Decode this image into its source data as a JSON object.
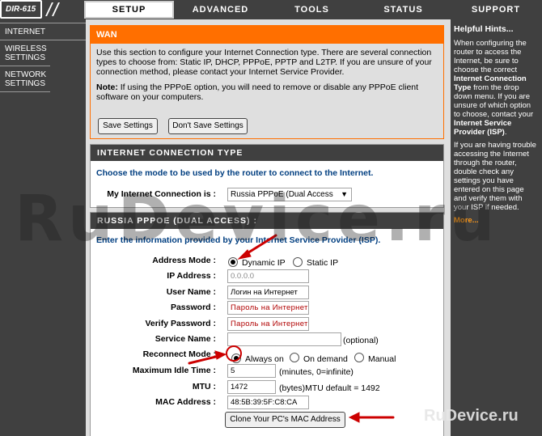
{
  "header": {
    "model": "DIR-615",
    "tabs": [
      "SETUP",
      "ADVANCED",
      "TOOLS",
      "STATUS",
      "SUPPORT"
    ],
    "active_tab": "SETUP"
  },
  "sidebar": {
    "items": [
      {
        "label": "INTERNET"
      },
      {
        "label": "WIRELESS SETTINGS"
      },
      {
        "label": "NETWORK SETTINGS"
      }
    ]
  },
  "wan": {
    "title": "WAN",
    "description": "Use this section to configure your Internet Connection type. There are several connection types to choose from: Static IP, DHCP, PPPoE, PPTP and L2TP. If you are unsure of your connection method, please contact your Internet Service Provider.",
    "note_label": "Note:",
    "note_text": "If using the PPPoE option, you will need to remove or disable any PPPoE client software on your computers.",
    "save_button": "Save Settings",
    "dont_save_button": "Don't Save Settings"
  },
  "connection_type": {
    "title": "INTERNET CONNECTION TYPE",
    "instruction": "Choose the mode to be used by the router to connect to the Internet.",
    "label": "My Internet Connection is :",
    "selected": "Russia PPPoE (Dual Access"
  },
  "pppoe": {
    "title": "RUSSIA PPPOE (DUAL ACCESS) :",
    "instruction": "Enter the information provided by your Internet Service Provider (ISP).",
    "address_mode_label": "Address Mode :",
    "dynamic_ip": "Dynamic IP",
    "static_ip": "Static IP",
    "ip_address_label": "IP Address :",
    "ip_address_value": "0.0.0.0",
    "username_label": "User Name :",
    "username_value": "Логин на Интернет",
    "password_label": "Password :",
    "password_value": "Пароль на Интернет",
    "verify_password_label": "Verify Password :",
    "verify_password_value": "Пароль на Интернет",
    "service_name_label": "Service Name :",
    "service_name_value": "",
    "service_name_hint": "(optional)",
    "reconnect_mode_label": "Reconnect Mode :",
    "always_on": "Always on",
    "on_demand": "On demand",
    "manual": "Manual",
    "idle_time_label": "Maximum Idle Time :",
    "idle_time_value": "5",
    "idle_time_hint": "(minutes, 0=infinite)",
    "mtu_label": "MTU :",
    "mtu_value": "1472",
    "mtu_hint": "(bytes)MTU default = 1492",
    "mac_label": "MAC Address :",
    "mac_value": "48:5B:39:5F:C8:CA",
    "clone_mac_button": "Clone Your PC's MAC Address"
  },
  "hints": {
    "title": "Helpful Hints...",
    "p1_a": "When configuring the router to access the Internet, be sure to choose the correct ",
    "p1_b": "Internet Connection Type",
    "p1_c": " from the drop down menu. If you are unsure of which option to choose, contact your ",
    "p1_d": "Internet Service Provider (ISP)",
    "p1_e": ".",
    "p2": "If you are having trouble accessing the Internet through the router, double check any settings you have entered on this page and verify them with your ISP if needed.",
    "more": "More..."
  },
  "watermark": {
    "big": "RuDevice.ru",
    "small": "RuDevice.ru"
  },
  "colors": {
    "accent_orange": "#ff6f00",
    "dark_bg": "#404040",
    "link_blue": "#003e80",
    "arrow_red": "#cc0000"
  }
}
